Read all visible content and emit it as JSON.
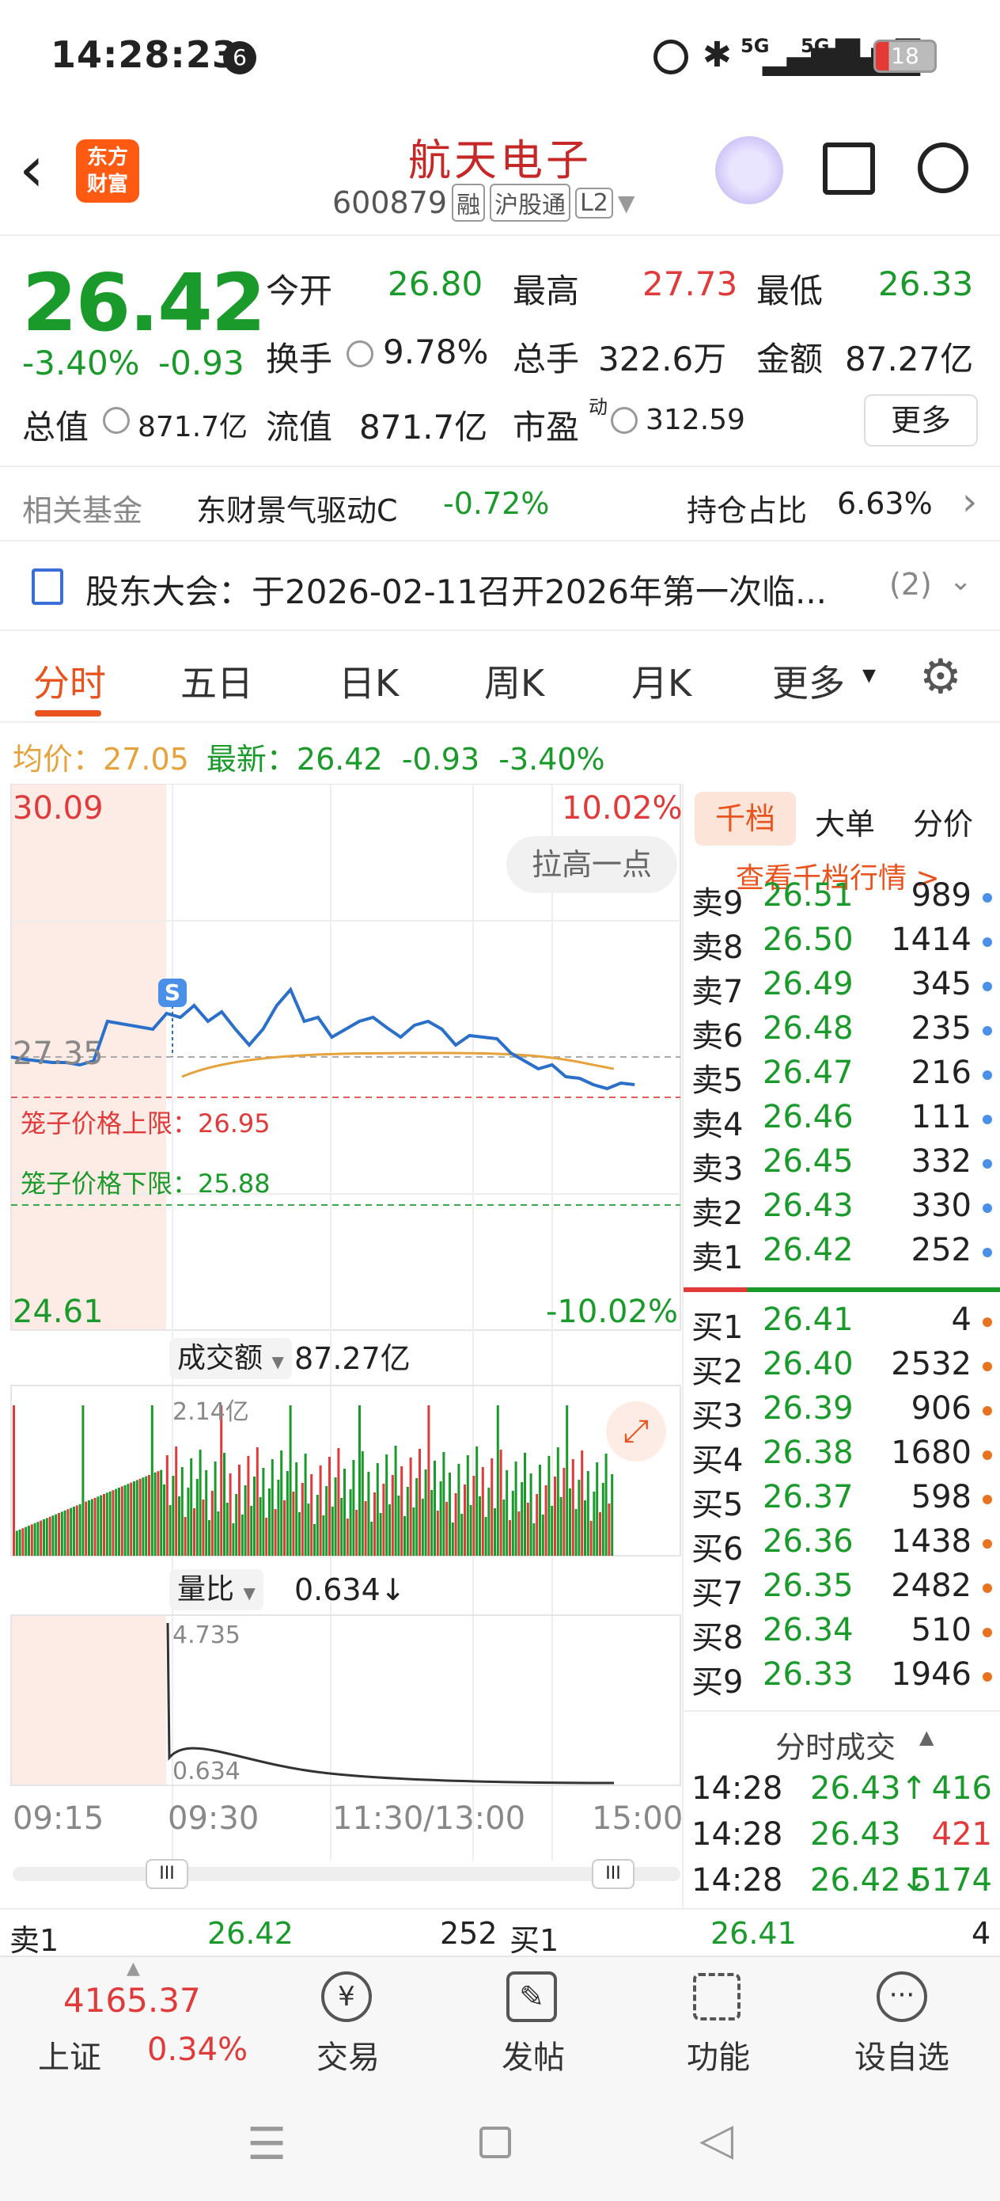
{
  "status": {
    "time": "14:28:23",
    "notif": "6",
    "net1": "5G",
    "net2": "5G",
    "battery": "18"
  },
  "header": {
    "logo_line1": "东方",
    "logo_line2": "财富",
    "title": "航天电子",
    "code": "600879",
    "tag1": "融",
    "tag2": "沪股通",
    "tag3": "L2"
  },
  "quote": {
    "price": "26.42",
    "pct": "-3.40%",
    "chg": "-0.93",
    "open_label": "今开",
    "open": "26.80",
    "high_label": "最高",
    "high": "27.73",
    "low_label": "最低",
    "low": "26.33",
    "turnover_label": "换手",
    "turnover": "9.78%",
    "vol_label": "总手",
    "vol": "322.6万",
    "amount_label": "金额",
    "amount": "87.27亿",
    "mcap_label": "总值",
    "mcap": "871.7亿",
    "float_label": "流值",
    "float": "871.7亿",
    "pe_label": "市盈",
    "pe_sup": "动",
    "pe": "312.59",
    "more": "更多"
  },
  "fund": {
    "label": "相关基金",
    "name": "东财景气驱动C",
    "pct": "-0.72%",
    "hold_label": "持仓占比",
    "hold": "6.63%"
  },
  "notice": {
    "text": "股东大会：于2026-02-11召开2026年第一次临...",
    "count": "(2)"
  },
  "tabs": [
    "分时",
    "五日",
    "日K",
    "周K",
    "月K",
    "更多"
  ],
  "avg": {
    "label": "均价：",
    "value": "27.05",
    "latest_label": "最新：",
    "latest": "26.42",
    "chg": "-0.93",
    "pct": "-3.40%"
  },
  "chart": {
    "top": "30.09",
    "top_pct": "10.02%",
    "bottom": "24.61",
    "bottom_pct": "-10.02%",
    "ref": "27.35",
    "cage_up": "笼子价格上限：26.95",
    "cage_down": "笼子价格下限：25.88",
    "push": "拉高一点",
    "s_marker": "S",
    "vol_label": "成交额",
    "vol_total": "87.27亿",
    "vol_max": "2.14亿",
    "ratio_label": "量比",
    "ratio_value": "0.634↓",
    "ratio_max": "4.735",
    "ratio_cur": "0.634",
    "times": [
      "09:15",
      "09:30",
      "11:30/13:00",
      "15:00"
    ]
  },
  "book_tabs": [
    "千档",
    "大单",
    "分价"
  ],
  "book_link": "查看千档行情 >",
  "asks": [
    [
      "卖9",
      "26.51",
      "989"
    ],
    [
      "卖8",
      "26.50",
      "1414"
    ],
    [
      "卖7",
      "26.49",
      "345"
    ],
    [
      "卖6",
      "26.48",
      "235"
    ],
    [
      "卖5",
      "26.47",
      "216"
    ],
    [
      "卖4",
      "26.46",
      "111"
    ],
    [
      "卖3",
      "26.45",
      "332"
    ],
    [
      "卖2",
      "26.43",
      "330"
    ],
    [
      "卖1",
      "26.42",
      "252"
    ]
  ],
  "bids": [
    [
      "买1",
      "26.41",
      "4"
    ],
    [
      "买2",
      "26.40",
      "2532"
    ],
    [
      "买3",
      "26.39",
      "906"
    ],
    [
      "买4",
      "26.38",
      "1680"
    ],
    [
      "买5",
      "26.37",
      "598"
    ],
    [
      "买6",
      "26.36",
      "1438"
    ],
    [
      "买7",
      "26.35",
      "2482"
    ],
    [
      "买8",
      "26.34",
      "510"
    ],
    [
      "买9",
      "26.33",
      "1946"
    ]
  ],
  "ticks_label": "分时成交",
  "ticks": [
    [
      "14:28",
      "26.43↑",
      "416"
    ],
    [
      "14:28",
      "26.43",
      "421"
    ],
    [
      "14:28",
      "26.42↓",
      "5174"
    ]
  ],
  "bottom_line": {
    "ask_label": "卖1",
    "ask_price": "26.42",
    "ask_vol": "252",
    "bid_label": "买1",
    "bid_price": "26.41",
    "bid_vol": "4"
  },
  "index": {
    "value": "4165.37",
    "name": "上证",
    "pct": "0.34%"
  },
  "nav": [
    "交易",
    "发帖",
    "功能",
    "设自选"
  ],
  "colors": {
    "up": "#e03a3a",
    "down": "#1a9a2a",
    "accent": "#e8531e",
    "line": "#2a6fc9",
    "avg": "#e6a23c"
  }
}
